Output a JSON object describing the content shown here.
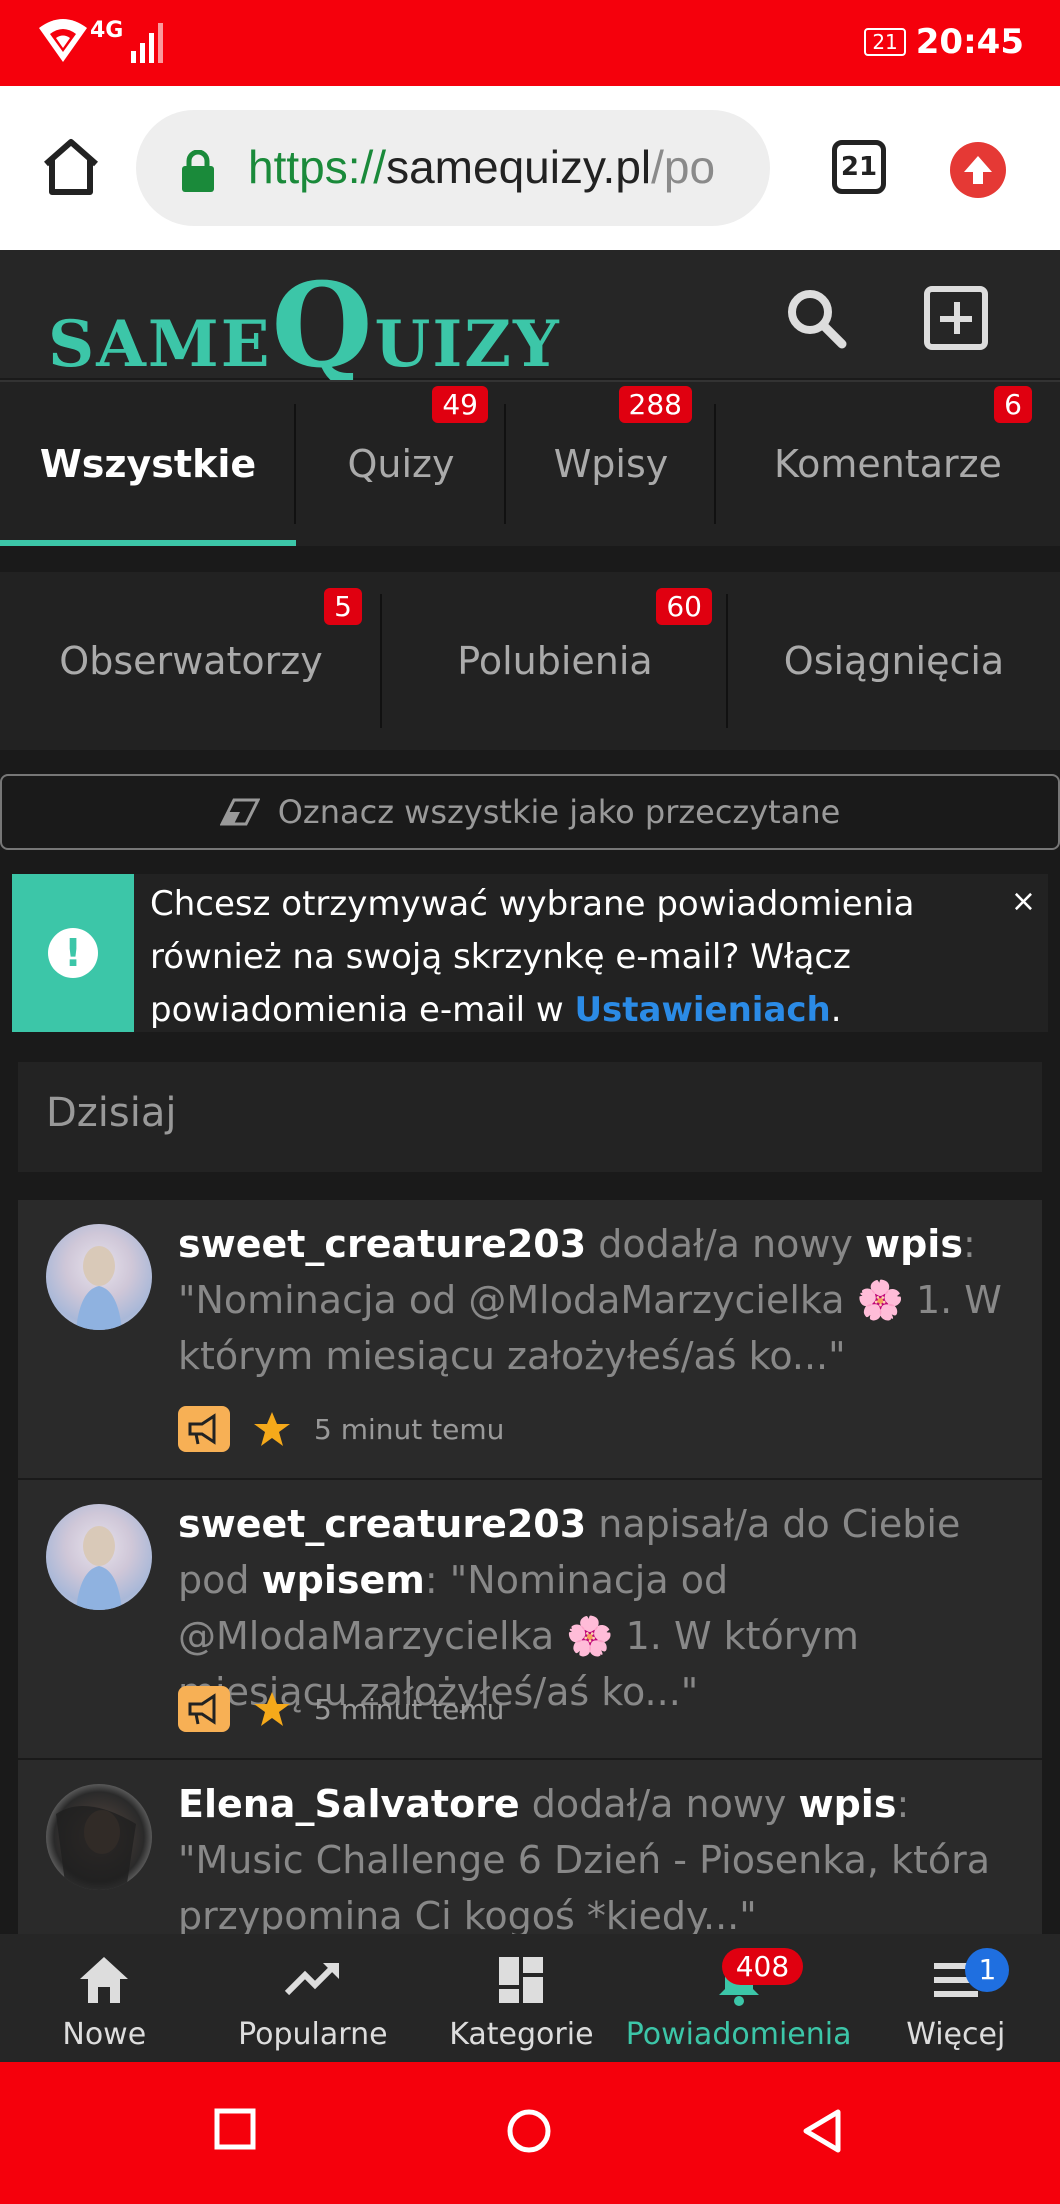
{
  "status_bar": {
    "network": "4G",
    "notification_count": "21",
    "time": "20:45"
  },
  "browser": {
    "url_scheme": "https://",
    "url_host": "samequizy.pl",
    "url_rest": "/po",
    "tab_count": "21"
  },
  "site": {
    "logo_small": "SAME",
    "logo_q": "Q",
    "logo_rest": "UIZY"
  },
  "tabs_row1": [
    {
      "label": "Wszystkie",
      "count": ""
    },
    {
      "label": "Quizy",
      "count": "49"
    },
    {
      "label": "Wpisy",
      "count": "288"
    },
    {
      "label": "Komentarze",
      "count": "6"
    }
  ],
  "tabs_row2": [
    {
      "label": "Obserwatorzy",
      "count": "5"
    },
    {
      "label": "Polubienia",
      "count": "60"
    },
    {
      "label": "Osiągnięcia",
      "count": ""
    }
  ],
  "mark_all_label": "Oznacz wszystkie jako przeczytane",
  "notice": {
    "text_before": "Chcesz otrzymywać wybrane powiadomienia również na swoją skrzynkę e-mail? Włącz powiadomienia e-mail w ",
    "link": "Ustawieniach",
    "text_after": ".",
    "close": "×"
  },
  "day_header": "Dzisiaj",
  "feed": [
    {
      "user": "sweet_creature203",
      "action": " dodał/a nowy ",
      "keyword": "wpis",
      "rest": ": \"Nominacja od @MlodaMarzycielka 🌸 1. W którym miesiącu założyłeś/aś ko...\"",
      "time": "5 minut temu"
    },
    {
      "user": "sweet_creature203",
      "action": " napisał/a do Ciebie pod ",
      "keyword": "wpisem",
      "rest": ": \"Nominacja od @MlodaMarzycielka 🌸 1. W którym miesiącu założyłeś/aś ko...\"",
      "time": "5 minut temu"
    },
    {
      "user": "Elena_Salvatore",
      "action": " dodał/a nowy ",
      "keyword": "wpis",
      "rest": ": \"Music Challenge 6 Dzień - Piosenka, która przypomina Ci kogoś *kiedy...\"",
      "time": ""
    }
  ],
  "bottom_nav": [
    {
      "label": "Nowe",
      "badge": ""
    },
    {
      "label": "Popularne",
      "badge": ""
    },
    {
      "label": "Kategorie",
      "badge": ""
    },
    {
      "label": "Powiadomienia",
      "badge": "408"
    },
    {
      "label": "Więcej",
      "badge": "1"
    }
  ],
  "colors": {
    "accent": "#3cc6a8",
    "status_bar": "#f5000c",
    "badge": "#e00010",
    "link": "#2b8be6"
  }
}
